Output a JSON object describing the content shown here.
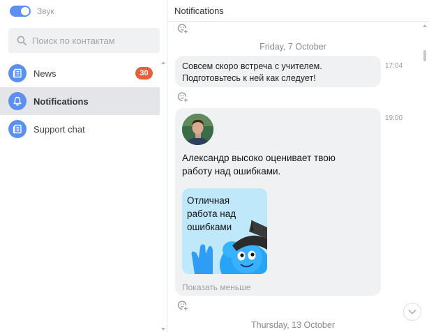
{
  "sidebar": {
    "sound": {
      "label": "Звук",
      "enabled": true
    },
    "search": {
      "placeholder": "Поиск по контактам",
      "value": ""
    },
    "contacts": [
      {
        "label": "News",
        "icon": "newspaper-icon",
        "badge": "30",
        "active": false
      },
      {
        "label": "Notifications",
        "icon": "bell-icon",
        "active": true
      },
      {
        "label": "Support chat",
        "icon": "newspaper-icon",
        "active": false
      }
    ]
  },
  "main": {
    "title": "Notifications",
    "dates": [
      "Friday, 7 October",
      "Thursday, 13 October"
    ],
    "messages": [
      {
        "text_line1": "Совсем скоро встреча с учителем.",
        "text_line2": "Подготовьтесь к ней как следует!",
        "time": "17:04"
      },
      {
        "avatar": "user-avatar",
        "text_line1": "Александр высоко оценивает твою",
        "text_line2": "работу над ошибками.",
        "card": {
          "line1": "Отличная",
          "line2": "работа над",
          "line3": "ошибками"
        },
        "show_less": "Показать меньше",
        "time": "19:00"
      }
    ]
  },
  "colors": {
    "accent": "#5b8ff0",
    "badge": "#e5603f",
    "bubble": "#f0f1f3",
    "card": "#bfe8fb",
    "active_row": "#e4e5e8"
  }
}
